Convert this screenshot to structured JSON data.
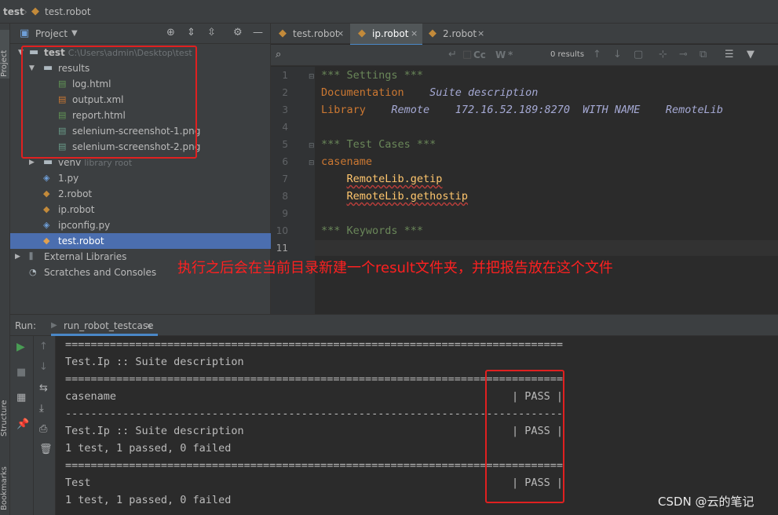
{
  "breadcrumb": {
    "project": "test",
    "file": "test.robot"
  },
  "left_strip": {
    "project_label": "Project",
    "structure_label": "Structure",
    "bookmarks_label": "Bookmarks"
  },
  "project_panel": {
    "title": "Project",
    "tree": [
      {
        "label": "test",
        "hint": "C:\\Users\\admin\\Desktop\\test",
        "icon": "folder-icon",
        "expanded": true
      },
      {
        "label": "results",
        "icon": "folder-icon",
        "expanded": true
      },
      {
        "label": "log.html",
        "icon": "html-file-icon"
      },
      {
        "label": "output.xml",
        "icon": "xml-file-icon"
      },
      {
        "label": "report.html",
        "icon": "html-file-icon"
      },
      {
        "label": "selenium-screenshot-1.png",
        "icon": "image-file-icon"
      },
      {
        "label": "selenium-screenshot-2.png",
        "icon": "image-file-icon"
      },
      {
        "label": "venv",
        "hint": "library root",
        "icon": "folder-icon"
      },
      {
        "label": "1.py",
        "icon": "python-file-icon"
      },
      {
        "label": "2.robot",
        "icon": "robot-file-icon"
      },
      {
        "label": "ip.robot",
        "icon": "robot-file-icon"
      },
      {
        "label": "ipconfig.py",
        "icon": "python-file-icon"
      },
      {
        "label": "test.robot",
        "icon": "robot-file-icon",
        "selected": true
      },
      {
        "label": "External Libraries",
        "icon": "library-icon"
      },
      {
        "label": "Scratches and Consoles",
        "icon": "scratches-icon"
      }
    ]
  },
  "editor": {
    "tabs": [
      {
        "label": "test.robot",
        "active": false
      },
      {
        "label": "ip.robot",
        "active": true
      },
      {
        "label": "2.robot",
        "active": false
      }
    ],
    "search": {
      "results": "0 results"
    },
    "lines": [
      {
        "n": "1",
        "segments": [
          {
            "text": "*** Settings ***",
            "color": "#6a8759"
          }
        ]
      },
      {
        "n": "2",
        "segments": [
          {
            "text": "Documentation",
            "color": "#cc7832"
          },
          {
            "text": "    Suite description",
            "color": "#a5a9d4",
            "italic": true
          }
        ]
      },
      {
        "n": "3",
        "segments": [
          {
            "text": "Library",
            "color": "#cc7832"
          },
          {
            "text": "    Remote    172.16.52.189:8270  WITH NAME    RemoteLib",
            "color": "#a5a9d4",
            "italic": true
          }
        ]
      },
      {
        "n": "4",
        "segments": []
      },
      {
        "n": "5",
        "segments": [
          {
            "text": "*** Test Cases ***",
            "color": "#6a8759"
          }
        ]
      },
      {
        "n": "6",
        "segments": [
          {
            "text": "casename",
            "color": "#cc7832"
          }
        ]
      },
      {
        "n": "7",
        "segments": [
          {
            "text": "    ",
            "color": "#a9b7c6"
          },
          {
            "text": "RemoteLib.getip",
            "color": "#ffc66d",
            "underline": true
          }
        ]
      },
      {
        "n": "8",
        "segments": [
          {
            "text": "    ",
            "color": "#a9b7c6"
          },
          {
            "text": "RemoteLib.gethostip",
            "color": "#ffc66d",
            "underline": true
          }
        ]
      },
      {
        "n": "9",
        "segments": []
      },
      {
        "n": "10",
        "segments": [
          {
            "text": "*** Keywords ***",
            "color": "#6a8759"
          }
        ]
      },
      {
        "n": "11",
        "segments": []
      }
    ]
  },
  "annotation": {
    "text": "执行之后会在当前目录新建一个result文件夹，并把报告放在这个文件"
  },
  "run_panel": {
    "label": "Run:",
    "tab": "run_robot_testcase",
    "console_lines": [
      "==============================================================================",
      "Test.Ip :: Suite description",
      "==============================================================================",
      "casename                                                              | PASS |",
      "------------------------------------------------------------------------------",
      "Test.Ip :: Suite description                                          | PASS |",
      "1 test, 1 passed, 0 failed",
      "==============================================================================",
      "Test                                                                  | PASS |",
      "1 test, 1 passed, 0 failed"
    ]
  },
  "watermark": "CSDN @云的笔记",
  "colors": {
    "accent": "#4a88c7",
    "selected_row": "#4b6eaf",
    "highlight_box": "#e02020",
    "annotation_text": "#ff2020"
  }
}
